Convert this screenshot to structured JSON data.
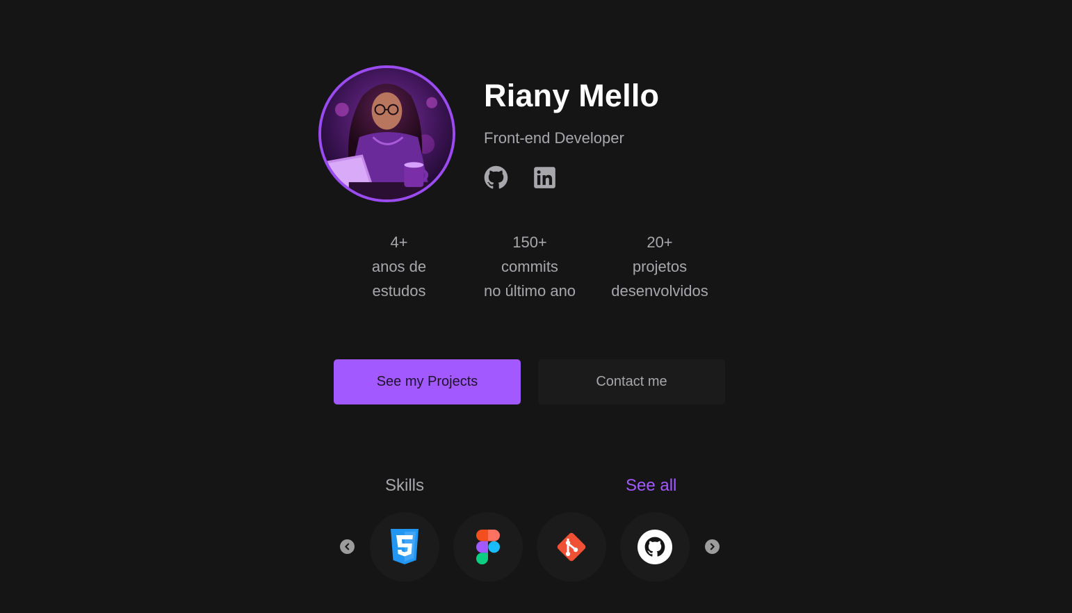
{
  "profile": {
    "name": "Riany Mello",
    "role": "Front-end Developer",
    "avatar_icon": "developer-avatar-illustration",
    "socials": [
      {
        "icon": "github-icon"
      },
      {
        "icon": "linkedin-icon"
      }
    ]
  },
  "stats": [
    {
      "value": "4+",
      "line1": "anos de",
      "line2": "estudos"
    },
    {
      "value": "150+",
      "line1": "commits",
      "line2": "no último ano"
    },
    {
      "value": "20+",
      "line1": "projetos",
      "line2": "desenvolvidos"
    }
  ],
  "actions": {
    "primary_label": "See my Projects",
    "secondary_label": "Contact me"
  },
  "skills": {
    "title": "Skills",
    "see_all": "See all",
    "items": [
      {
        "icon": "css3-icon"
      },
      {
        "icon": "figma-icon"
      },
      {
        "icon": "git-icon"
      },
      {
        "icon": "github-icon"
      }
    ]
  },
  "colors": {
    "background": "#151515",
    "accent": "#a259ff",
    "avatar_ring": "#9a4cf0",
    "surface": "#1b1b1b",
    "text_muted": "#a8a8ac",
    "text_strong": "#ffffff"
  }
}
